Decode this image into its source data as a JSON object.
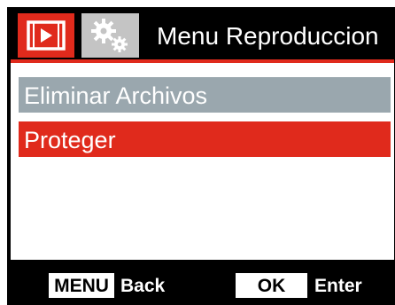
{
  "header": {
    "title": "Menu Reproduccion",
    "tabs": [
      {
        "icon": "playback-icon",
        "active": true
      },
      {
        "icon": "settings-gears-icon",
        "active": false
      }
    ]
  },
  "menu": {
    "items": [
      {
        "label": "Eliminar Archivos",
        "state": "normal"
      },
      {
        "label": "Proteger",
        "state": "selected"
      }
    ]
  },
  "footer": {
    "menu_key": "MENU",
    "menu_action": "Back",
    "ok_key": "OK",
    "ok_action": "Enter"
  },
  "colors": {
    "accent": "#e02a1c",
    "item_normal": "#9aa7ae",
    "tab_inactive": "#c4c4c4",
    "background": "#000000"
  }
}
